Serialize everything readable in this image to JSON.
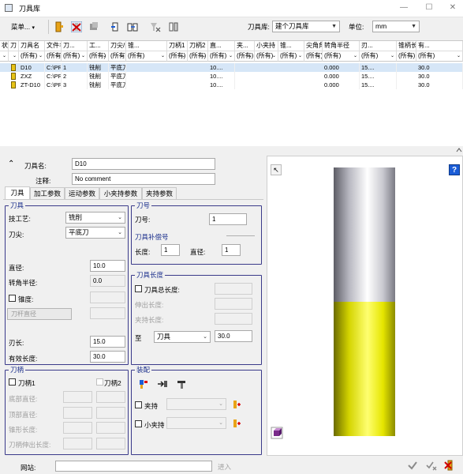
{
  "window": {
    "title": "刀具库"
  },
  "toolbar": {
    "menu_label": "菜单...",
    "library_label": "刀具库:",
    "library_value": "建个刀具库",
    "unit_label": "单位:",
    "unit_value": "mm"
  },
  "grid": {
    "headers": [
      "状",
      "刀",
      "刀具名",
      "文件名",
      "刀...",
      "工...",
      "刀尖/类型",
      "锥...",
      "刀柄1",
      "刀柄2",
      "直...",
      "夹...",
      "小夹持",
      "锥...",
      "尖角角度",
      "转角半径",
      "刃...",
      "锥柄长度",
      "有..."
    ],
    "filter_all": "(所有)",
    "rows": [
      {
        "name": "D10",
        "file": "C:\\PR...",
        "num": "1",
        "process": "铣削",
        "tip": "平底刀",
        "dia": "10....",
        "radius": "0.000",
        "flute": "15....",
        "eff": "30.0"
      },
      {
        "name": "ZXZ",
        "file": "C:\\PR...",
        "num": "2",
        "process": "铣削",
        "tip": "平底刀",
        "dia": "10....",
        "radius": "0.000",
        "flute": "15....",
        "eff": "30.0"
      },
      {
        "name": "ZT-D10",
        "file": "C:\\PR...",
        "num": "3",
        "process": "铣削",
        "tip": "平底刀",
        "dia": "10....",
        "radius": "0.000",
        "flute": "15....",
        "eff": "30.0"
      }
    ]
  },
  "detail": {
    "name_label": "刀具名:",
    "name_value": "D10",
    "comment_label": "注释:",
    "comment_value": "No comment",
    "tabs": [
      "刀具",
      "加工参数",
      "运动参数",
      "小夹持参数",
      "夹持参数"
    ]
  },
  "tool_group": {
    "title": "刀具",
    "process_label": "技工艺:",
    "process_value": "铣削",
    "tip_label": "刀尖:",
    "tip_value": "平底刀",
    "diameter_label": "直径:",
    "diameter_value": "10.0",
    "corner_label": "转角半径:",
    "corner_value": "0.0",
    "taper_label": "锥度:",
    "shank_btn": "刀杆直径",
    "flute_label": "刃长:",
    "flute_value": "15.0",
    "effective_label": "有效长度:",
    "effective_value": "30.0"
  },
  "number_group": {
    "title": "刀号",
    "number_label": "刀号:",
    "number_value": "1",
    "offset_label": "刀具补偿号",
    "length_label": "长度:",
    "length_value": "1",
    "diameter_label": "直径:",
    "diameter_value": "1"
  },
  "length_group": {
    "title": "刀具长度",
    "total_label": "刀具总长度:",
    "stickout_label": "伸出长度:",
    "holder_label": "夹持长度:",
    "to_label": "至",
    "to_value": "刀具",
    "to_length": "30.0"
  },
  "shank_group": {
    "title": "刀柄",
    "shank1_label": "刀柄1",
    "shank2_label": "刀柄2",
    "bottom_dia_label": "底部直径:",
    "top_dia_label": "顶部直径:",
    "taper_len_label": "锥形长度:",
    "extension_label": "刀柄伸出长度:"
  },
  "assembly_group": {
    "title": "装配",
    "holder_label": "夹持",
    "small_holder_label": "小夹持"
  },
  "footer": {
    "url_label": "网站:",
    "go_label": "进入"
  },
  "colors": {
    "group_border": "#3a3a8a",
    "group_title": "#1b2f8c",
    "tool_flute": "#e6e600",
    "tool_shank": "#c8c8cc"
  }
}
